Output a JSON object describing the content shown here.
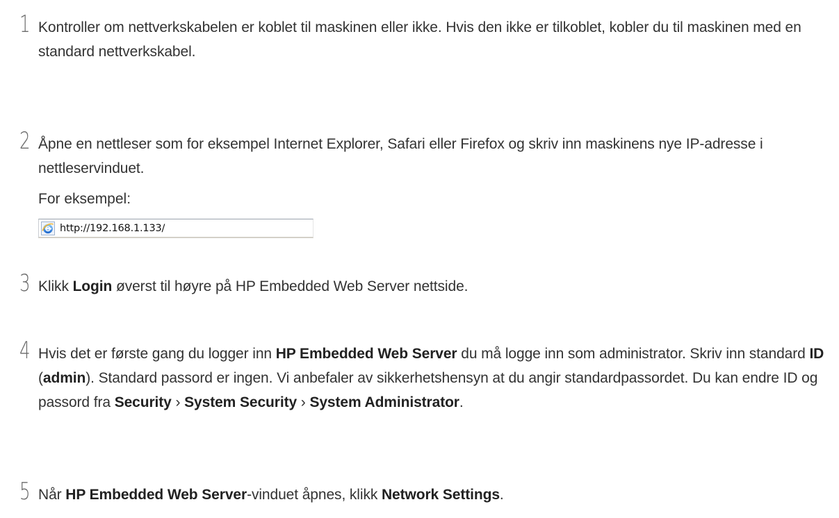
{
  "steps": [
    {
      "number": "1",
      "text": "Kontroller om nettverkskabelen er koblet til maskinen eller ikke. Hvis den ikke er tilkoblet, kobler du til maskinen med en standard nettverkskabel."
    },
    {
      "number": "2",
      "text": "Åpne en nettleser som for eksempel Internet Explorer, Safari eller Firefox og skriv inn maskinens nye IP-adresse i nettleservinduet.",
      "example_label": "For eksempel:",
      "example_url": "http://192.168.1.133/",
      "example_icon": "internet-explorer-icon"
    },
    {
      "number": "3",
      "t1": "Klikk ",
      "b1": "Login",
      "t2": " øverst til høyre på HP Embedded Web Server nettside."
    },
    {
      "number": "4",
      "t1": "Hvis det er første gang du logger inn ",
      "b1": "HP Embedded Web Server",
      "t2": " du må logge inn som administrator. Skriv inn standard ",
      "b2": "ID",
      "t3": " (",
      "b3": "admin",
      "t4": "). Standard passord er ingen. Vi anbefaler av sikkerhetshensyn at du angir standardpassordet. Du kan endre ID og passord fra ",
      "b4": "Security",
      "t5": " › ",
      "b5": "System Security",
      "t6": " › ",
      "b6": "System Administrator",
      "t7": "."
    },
    {
      "number": "5",
      "t1": "Når ",
      "b1": "HP Embedded Web Server",
      "t2": "-vinduet åpnes, klikk ",
      "b2": "Network Settings",
      "t3": "."
    }
  ]
}
